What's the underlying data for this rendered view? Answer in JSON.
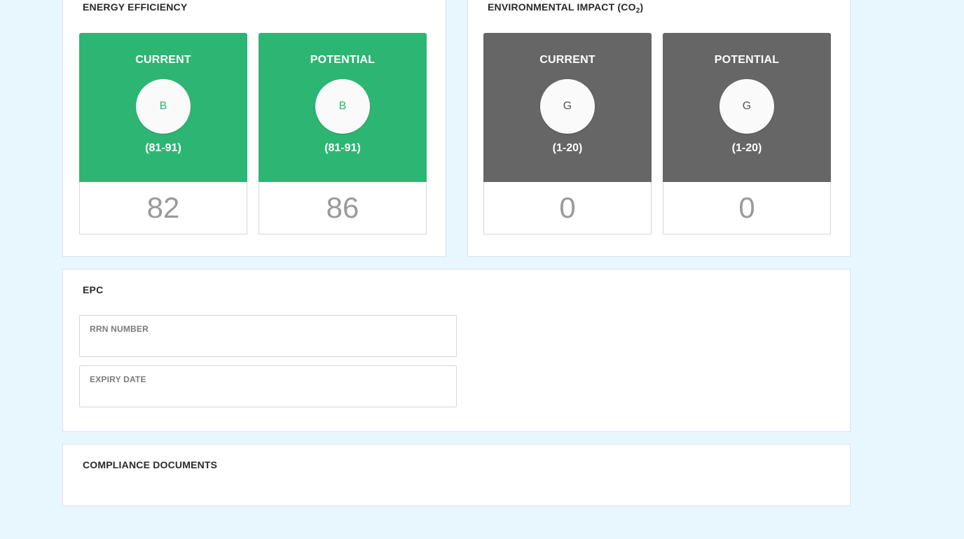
{
  "energy_efficiency": {
    "title": "ENERGY EFFICIENCY",
    "color": "#2db673",
    "current": {
      "label": "CURRENT",
      "band": "B",
      "range": "(81-91)",
      "score": "82"
    },
    "potential": {
      "label": "POTENTIAL",
      "band": "B",
      "range": "(81-91)",
      "score": "86"
    }
  },
  "environmental_impact": {
    "title_main": "ENVIRONMENTAL IMPACT (CO",
    "title_sub": "2",
    "title_end": ")",
    "color": "#666666",
    "current": {
      "label": "CURRENT",
      "band": "G",
      "range": "(1-20)",
      "score": "0"
    },
    "potential": {
      "label": "POTENTIAL",
      "band": "G",
      "range": "(1-20)",
      "score": "0"
    }
  },
  "epc": {
    "title": "EPC",
    "rrn": {
      "label": "RRN NUMBER",
      "value": ""
    },
    "expiry": {
      "label": "EXPIRY DATE",
      "value": ""
    }
  },
  "compliance": {
    "title": "COMPLIANCE DOCUMENTS"
  }
}
